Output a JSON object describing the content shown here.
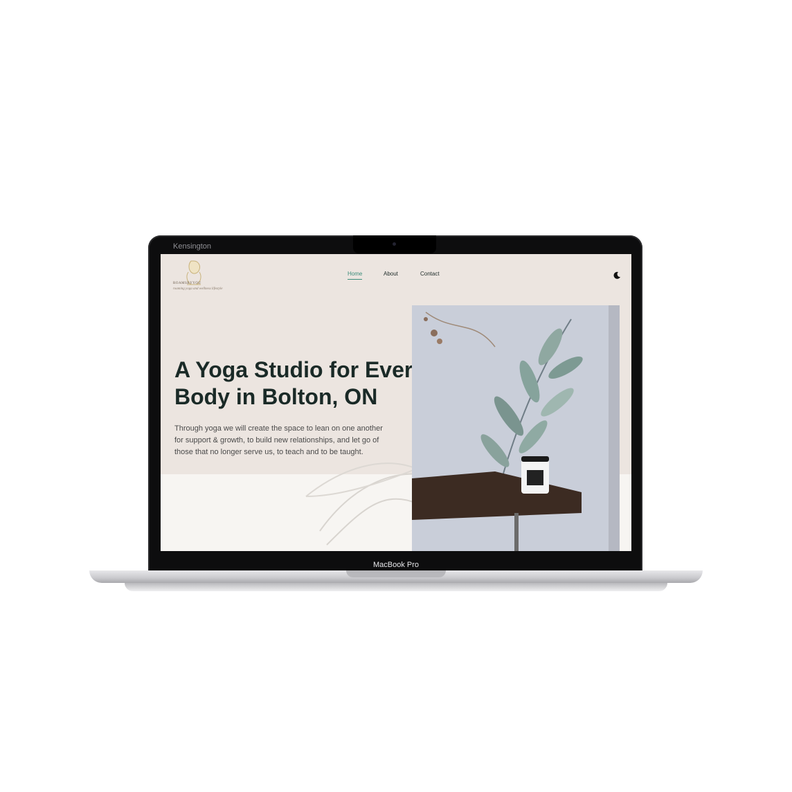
{
  "device": {
    "lid_brand": "Kensington",
    "model_label": "MacBook Pro"
  },
  "site": {
    "logo_name": "ROAMSBYYOU",
    "logo_tagline": "roaming yoga and wellness lifestyle",
    "nav": [
      {
        "label": "Home",
        "active": true
      },
      {
        "label": "About",
        "active": false
      },
      {
        "label": "Contact",
        "active": false
      }
    ],
    "theme_toggle_icon": "moon-icon",
    "hero": {
      "title": "A Yoga Studio for Every Body in Bolton, ON",
      "description": "Through yoga we will create the space to lean on one another for support & growth, to build new relationships, and let go of those that no longer serve us, to teach and to be taught."
    },
    "colors": {
      "hero_background": "#ece5e0",
      "accent": "#3a8c7a",
      "headline": "#1a2a27"
    }
  }
}
